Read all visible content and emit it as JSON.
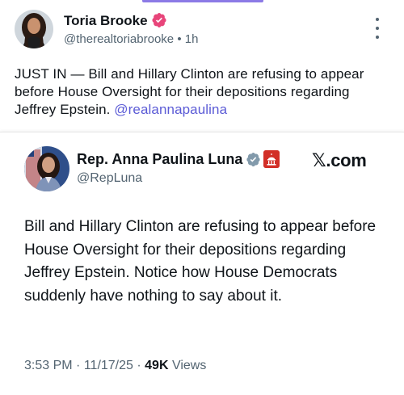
{
  "post": {
    "author_name": "Toria Brooke",
    "handle": "@therealtoriabrooke",
    "separator": "•",
    "time": "1h",
    "text": "JUST IN — Bill and Hillary Clinton are refusing to appear before House Oversight for their depositions regarding Jeffrey Epstein. ",
    "mention": "@realannapaulina"
  },
  "quote": {
    "author_name": "Rep. Anna Paulina Luna",
    "handle": "@RepLuna",
    "source_logo": "𝕏.com",
    "text": "Bill and Hillary Clinton are refusing to appear before House Oversight for their depositions regarding Jeffrey Epstein. Notice how House Democrats suddenly have nothing to say about it.",
    "time": "3:53 PM",
    "date": "11/17/25",
    "dot": "·",
    "views_count": "49K",
    "views_label": "Views"
  },
  "colors": {
    "link": "#5b5bd6",
    "secondary_text": "#536471",
    "verified_badge": "#e8457a",
    "gov_badge": "#829aab",
    "flag_red": "#d22f27"
  },
  "icons": {
    "verified": "verified-badge-icon",
    "government": "government-badge-icon",
    "more": "more-options-icon",
    "flag": "congress-flag-icon"
  }
}
